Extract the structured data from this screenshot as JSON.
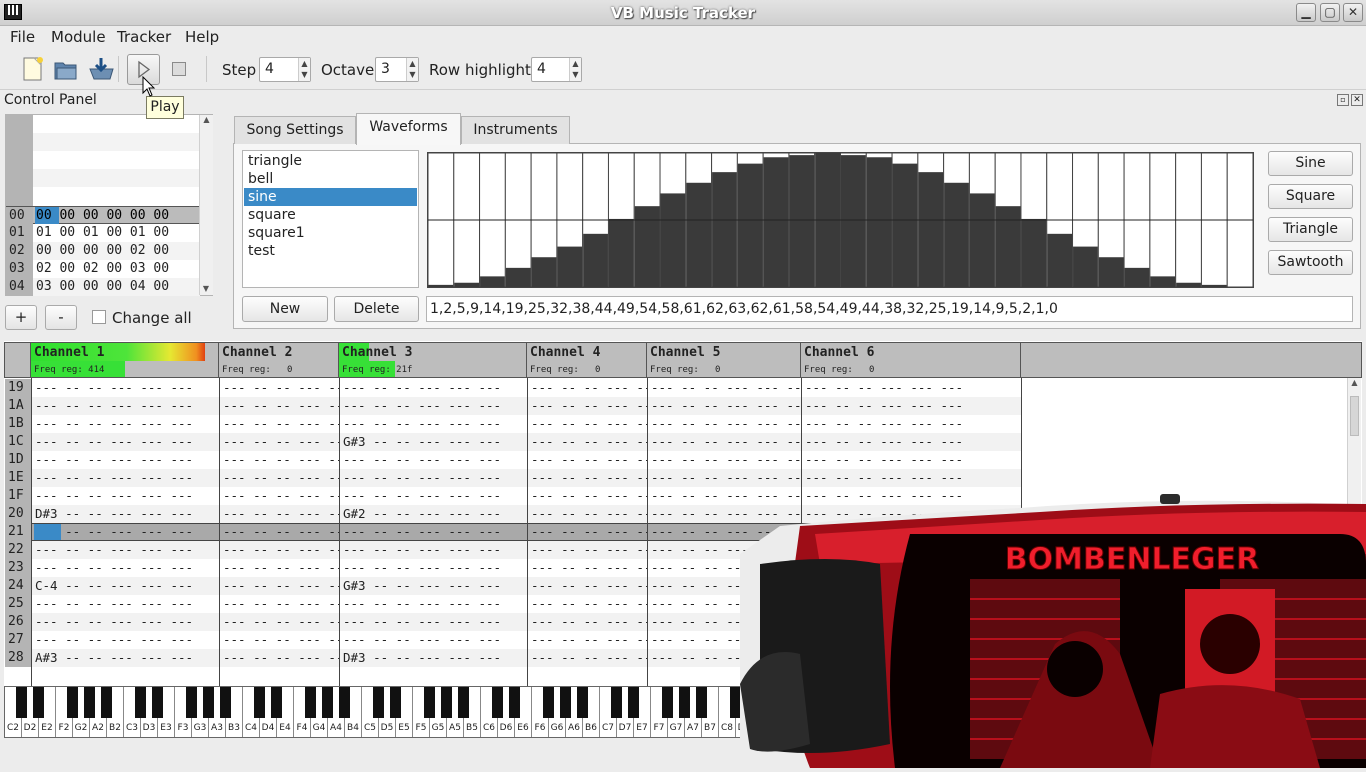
{
  "window": {
    "title": "VB Music Tracker"
  },
  "menu": [
    "File",
    "Module",
    "Tracker",
    "Help"
  ],
  "toolbar": {
    "step_label": "Step",
    "step_value": "4",
    "octave_label": "Octave",
    "octave_value": "3",
    "highlight_label": "Row highlight",
    "highlight_value": "4",
    "tooltip": "Play"
  },
  "control_panel": {
    "title": "Control Panel",
    "patterns": [
      {
        "num": "00",
        "vals": "00 00 00 00 00 00"
      },
      {
        "num": "01",
        "vals": "01 00 01 00 01 00"
      },
      {
        "num": "02",
        "vals": "00 00 00 00 02 00"
      },
      {
        "num": "03",
        "vals": "02 00 02 00 03 00"
      },
      {
        "num": "04",
        "vals": "03 00 00 00 04 00"
      }
    ],
    "add_label": "+",
    "remove_label": "-",
    "change_all_label": "Change all"
  },
  "tabs": [
    "Song Settings",
    "Waveforms",
    "Instruments"
  ],
  "waveforms": {
    "items": [
      "triangle",
      "bell",
      "sine",
      "square",
      "square1",
      "test"
    ],
    "selected": "sine",
    "buttons": [
      "Sine",
      "Square",
      "Triangle",
      "Sawtooth"
    ],
    "new_label": "New",
    "delete_label": "Delete",
    "values_text": "1,2,5,9,14,19,25,32,38,44,49,54,58,61,62,63,62,61,58,54,49,44,38,32,25,19,14,9,5,2,1,0",
    "values": [
      1,
      2,
      5,
      9,
      14,
      19,
      25,
      32,
      38,
      44,
      49,
      54,
      58,
      61,
      62,
      63,
      62,
      61,
      58,
      54,
      49,
      44,
      38,
      32,
      25,
      19,
      14,
      9,
      5,
      2,
      1,
      0
    ]
  },
  "channels": [
    {
      "name": "Channel 1",
      "freq": "Freq reg: 414"
    },
    {
      "name": "Channel 2",
      "freq": "Freq reg:   0"
    },
    {
      "name": "Channel 3",
      "freq": "Freq reg: 21f"
    },
    {
      "name": "Channel 4",
      "freq": "Freq reg:   0"
    },
    {
      "name": "Channel 5",
      "freq": "Freq reg:   0"
    },
    {
      "name": "Channel 6",
      "freq": "Freq reg:   0"
    }
  ],
  "rows": [
    {
      "num": "19",
      "c1": "",
      "c3": ""
    },
    {
      "num": "1A",
      "c1": "",
      "c3": ""
    },
    {
      "num": "1B",
      "c1": "",
      "c3": ""
    },
    {
      "num": "1C",
      "c1": "",
      "c3": "G#3"
    },
    {
      "num": "1D",
      "c1": "",
      "c3": ""
    },
    {
      "num": "1E",
      "c1": "",
      "c3": ""
    },
    {
      "num": "1F",
      "c1": "",
      "c3": ""
    },
    {
      "num": "20",
      "c1": "D#3",
      "c3": "G#2"
    },
    {
      "num": "21",
      "c1": "",
      "c3": ""
    },
    {
      "num": "22",
      "c1": "",
      "c3": ""
    },
    {
      "num": "23",
      "c1": "",
      "c3": ""
    },
    {
      "num": "24",
      "c1": "C-4",
      "c3": "G#3"
    },
    {
      "num": "25",
      "c1": "",
      "c3": ""
    },
    {
      "num": "26",
      "c1": "",
      "c3": ""
    },
    {
      "num": "27",
      "c1": "",
      "c3": ""
    },
    {
      "num": "28",
      "c1": "A#3",
      "c3": "D#3"
    }
  ],
  "keyboard": [
    "C2",
    "D2",
    "E2",
    "F2",
    "G2",
    "A2",
    "B2",
    "C3",
    "D3",
    "E3",
    "F3",
    "G3",
    "A3",
    "B3",
    "C4",
    "D4",
    "E4",
    "F4",
    "G4",
    "A4",
    "B4",
    "C5",
    "D5",
    "E5",
    "F5",
    "G5",
    "A5",
    "B5",
    "C6",
    "D6",
    "E6",
    "F6",
    "G6",
    "A6",
    "B6",
    "C7",
    "D7",
    "E7",
    "F7",
    "G7",
    "A7",
    "B7",
    "C8",
    "D8"
  ],
  "overlay": {
    "logo_text": "BOMBENLEGER"
  },
  "colors": {
    "selection": "#3a8ac7",
    "highlight_row": "#a9a9a9",
    "photo_red": "#c8101e"
  }
}
